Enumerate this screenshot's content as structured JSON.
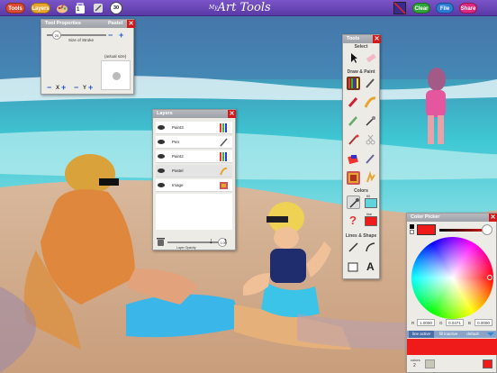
{
  "topbar": {
    "tools_label": "Tools",
    "layers_label": "Layers",
    "app_title_prefix": "My",
    "app_title": "Art Tools",
    "clear_label": "Clear",
    "file_label": "File",
    "share_label": "Share",
    "badge_a": "1",
    "badge_b": "30",
    "colors": {
      "purple": "#6a47bd",
      "orange": "#e8761a",
      "green": "#2fa43a",
      "blue": "#2b7bd8",
      "pink": "#e0287f"
    }
  },
  "tool_properties": {
    "title": "Tool Properties",
    "tool_name": "Pastel",
    "size_value": "20",
    "size_label": "Size of Stroke",
    "actual_size_label": "(actual size)",
    "x_label": "X",
    "y_label": "Y",
    "minus": "−",
    "plus": "+"
  },
  "tools_panel": {
    "title": "Tools",
    "sections": {
      "select": "Select",
      "draw": "Draw & Paint",
      "colors": "Colors",
      "lines": "Lines & Shape"
    },
    "fill_label": "fill",
    "line_label": "line",
    "text_tool": "A",
    "question": "?",
    "icons": [
      "arrow-icon",
      "eraser-icon",
      "crayons-icon",
      "pencil-icon",
      "marker-icon",
      "brush-icon",
      "chalk-icon",
      "splatter-icon",
      "stamp-icon",
      "scissors-icon",
      "bucket-icon",
      "pastel-icon",
      "gradient-icon",
      "sparkle-icon",
      "dropper-icon",
      "line-icon",
      "curve-icon",
      "shape-icon"
    ]
  },
  "layers_panel": {
    "title": "Layers",
    "rows": [
      {
        "name": "Paint3",
        "active": false
      },
      {
        "name": "Pen",
        "active": false
      },
      {
        "name": "Paint2",
        "active": false
      },
      {
        "name": "Pastel",
        "active": true
      },
      {
        "name": "Image",
        "active": false
      }
    ],
    "opacity_value": "1.00",
    "opacity_label": "Layer Opacity"
  },
  "color_picker": {
    "title": "Color Picker",
    "current_color": "#ef1b1b",
    "r_label": "R",
    "r_value": "1.0000",
    "g_label": "G",
    "g_value": "0.0471",
    "b_label": "B",
    "b_value": "0.0000",
    "tabs": {
      "line": "line active",
      "fill": "fill inactive",
      "default": "default"
    },
    "colors_label": "colors",
    "colors_count": "2"
  }
}
